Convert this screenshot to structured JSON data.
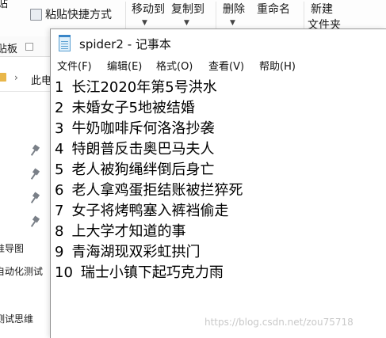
{
  "explorer": {
    "ribbon": {
      "paste_partial": "贴",
      "paste_shortcut": "粘贴快捷方式",
      "move_to": "移动到",
      "copy_to": "复制到",
      "delete": "删除",
      "rename": "重命名",
      "new": "新建",
      "new_folder_partial": "文件夹",
      "clipboard_group_partial": "贴板"
    },
    "address": {
      "path_partial": "此电"
    },
    "nav_items": [
      {
        "label": "准导图"
      },
      {
        "label": "自动化测试"
      },
      {
        "label": "测试思维"
      }
    ]
  },
  "notepad": {
    "title": "spider2 - 记事本",
    "menu": [
      "文件(F)",
      "编辑(E)",
      "格式(O)",
      "查看(V)",
      "帮助(H)"
    ],
    "lines": [
      {
        "num": "1",
        "text": "长江2020年第5号洪水"
      },
      {
        "num": "2",
        "text": "未婚女子5地被结婚"
      },
      {
        "num": "3",
        "text": "牛奶咖啡斥何洛洛抄袭"
      },
      {
        "num": "4",
        "text": "特朗普反击奥巴马夫人"
      },
      {
        "num": "5",
        "text": "老人被狗绳绊倒后身亡"
      },
      {
        "num": "6",
        "text": "老人拿鸡蛋拒结账被拦猝死"
      },
      {
        "num": "7",
        "text": "女子将烤鸭塞入裤裆偷走"
      },
      {
        "num": "8",
        "text": "上大学才知道的事"
      },
      {
        "num": "9",
        "text": "青海湖现双彩虹拱门"
      },
      {
        "num": "10",
        "text": "瑞士小镇下起巧克力雨"
      }
    ]
  },
  "watermark": "https://blog.csdn.net/zou75718"
}
